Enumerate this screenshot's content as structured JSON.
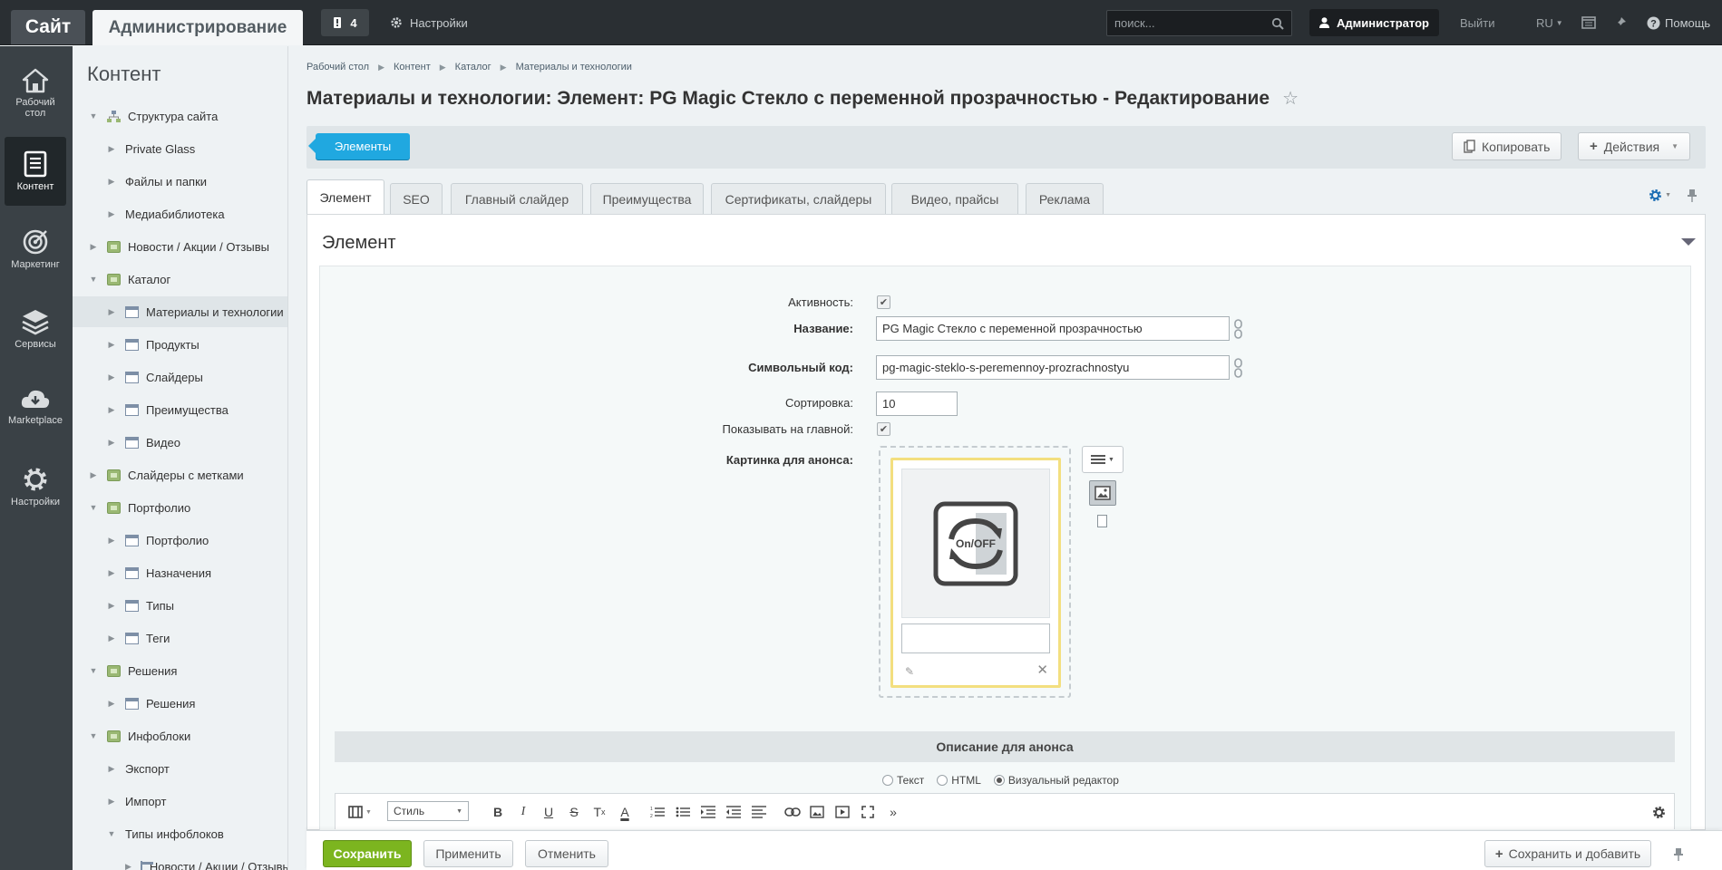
{
  "top": {
    "site_tab": "Сайт",
    "admin_tab": "Администрирование",
    "notifications_count": "4",
    "settings": "Настройки",
    "search_placeholder": "поиск...",
    "user": "Администратор",
    "logout": "Выйти",
    "lang": "RU",
    "help": "Помощь"
  },
  "rail": [
    {
      "label": "Рабочий стол",
      "icon": "house-icon"
    },
    {
      "label": "Контент",
      "icon": "document-icon"
    },
    {
      "label": "Маркетинг",
      "icon": "target-icon"
    },
    {
      "label": "Сервисы",
      "icon": "layers-icon"
    },
    {
      "label": "Marketplace",
      "icon": "cloud-download-icon"
    },
    {
      "label": "Настройки",
      "icon": "gear-icon"
    }
  ],
  "tree": {
    "title": "Контент",
    "items": [
      {
        "label": "Структура сайта",
        "level": 0,
        "open": true,
        "icon": "struct"
      },
      {
        "label": "Private Glass",
        "level": 1,
        "open": false,
        "icon": "none"
      },
      {
        "label": "Файлы и папки",
        "level": 1,
        "open": false,
        "icon": "none"
      },
      {
        "label": "Медиабиблиотека",
        "level": 1,
        "open": false,
        "icon": "none"
      },
      {
        "label": "Новости / Акции / Отзывы",
        "level": 0,
        "open": false,
        "icon": "folder"
      },
      {
        "label": "Каталог",
        "level": 0,
        "open": true,
        "icon": "folder"
      },
      {
        "label": "Материалы и технологии",
        "level": 1,
        "open": false,
        "icon": "list",
        "selected": true
      },
      {
        "label": "Продукты",
        "level": 1,
        "open": false,
        "icon": "list"
      },
      {
        "label": "Слайдеры",
        "level": 1,
        "open": false,
        "icon": "list"
      },
      {
        "label": "Преимущества",
        "level": 1,
        "open": false,
        "icon": "list"
      },
      {
        "label": "Видео",
        "level": 1,
        "open": false,
        "icon": "list"
      },
      {
        "label": "Слайдеры с метками",
        "level": 0,
        "open": false,
        "icon": "folder"
      },
      {
        "label": "Портфолио",
        "level": 0,
        "open": true,
        "icon": "folder"
      },
      {
        "label": "Портфолио",
        "level": 1,
        "open": false,
        "icon": "list"
      },
      {
        "label": "Назначения",
        "level": 1,
        "open": false,
        "icon": "list"
      },
      {
        "label": "Типы",
        "level": 1,
        "open": false,
        "icon": "list"
      },
      {
        "label": "Теги",
        "level": 1,
        "open": false,
        "icon": "list"
      },
      {
        "label": "Решения",
        "level": 0,
        "open": true,
        "icon": "folder"
      },
      {
        "label": "Решения",
        "level": 1,
        "open": false,
        "icon": "list"
      },
      {
        "label": "Инфоблоки",
        "level": 0,
        "open": true,
        "icon": "folder"
      },
      {
        "label": "Экспорт",
        "level": 1,
        "open": false,
        "icon": "none"
      },
      {
        "label": "Импорт",
        "level": 1,
        "open": false,
        "icon": "none"
      },
      {
        "label": "Типы инфоблоков",
        "level": 1,
        "open": true,
        "icon": "none"
      },
      {
        "label": "Новости / Акции / Отзывы",
        "level": 2,
        "open": false,
        "icon": "list"
      }
    ]
  },
  "breadcrumb": [
    "Рабочий стол",
    "Контент",
    "Каталог",
    "Материалы и технологии"
  ],
  "page_title": "Материалы и технологии: Элемент: PG Magic Стекло с переменной прозрачностью - Редактирование",
  "toolbar": {
    "elements": "Элементы",
    "copy": "Копировать",
    "actions": "Действия"
  },
  "tabs": [
    "Элемент",
    "SEO",
    "Главный слайдер",
    "Преимущества",
    "Сертификаты, слайдеры",
    "Видео, прайсы",
    "Реклама"
  ],
  "section_title": "Элемент",
  "form": {
    "active_label": "Активность:",
    "name_label": "Название:",
    "name_value": "PG Magic Стекло с переменной прозрачностью",
    "code_label": "Символьный код:",
    "code_value": "pg-magic-steklo-s-peremennoy-prozrachnostyu",
    "sort_label": "Сортировка:",
    "sort_value": "10",
    "show_main_label": "Показывать на главной:",
    "preview_label": "Картинка для анонса:",
    "image_text": "On/OFF"
  },
  "description": {
    "title": "Описание для анонса",
    "modes": [
      "Текст",
      "HTML",
      "Визуальный редактор"
    ],
    "selected_mode": 2,
    "style_label": "Стиль"
  },
  "bottom": {
    "save": "Сохранить",
    "apply": "Применить",
    "cancel": "Отменить",
    "save_add": "Сохранить и добавить"
  }
}
